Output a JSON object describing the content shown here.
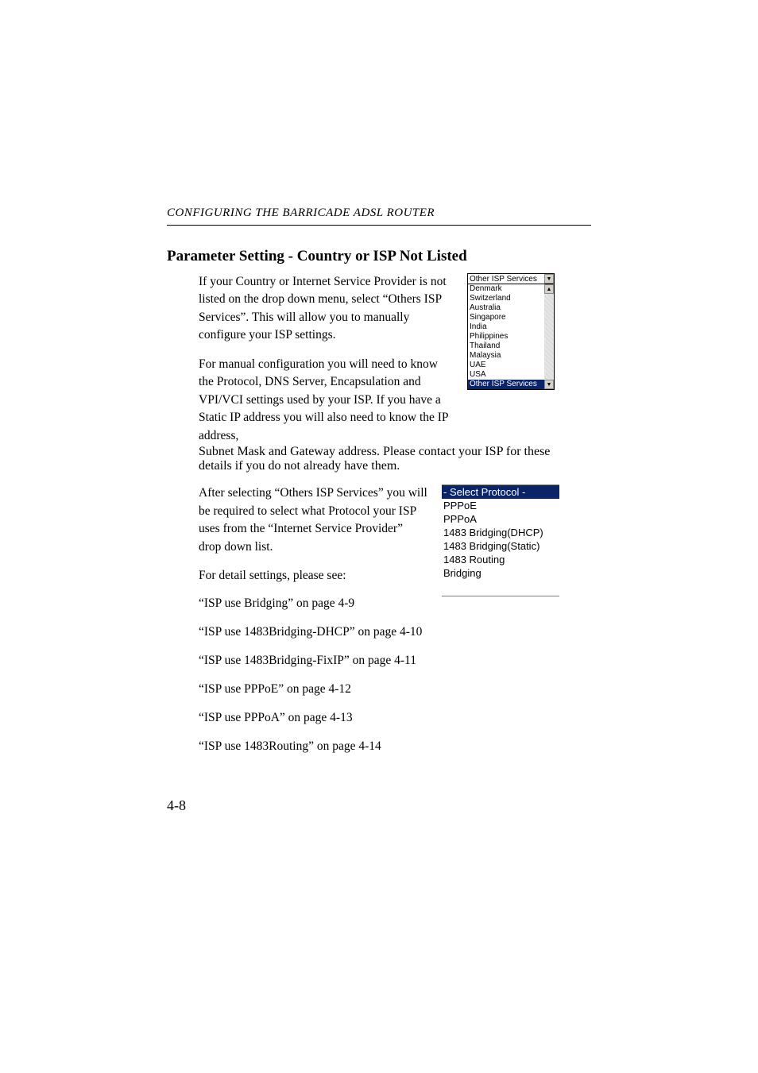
{
  "running_head": "CONFIGURING THE BARRICADE ADSL ROUTER",
  "section_heading": "Parameter Setting - Country or ISP Not Listed",
  "para1": "If your Country or Internet Service Provider is not listed on the drop down menu, select “Others ISP Services”. This will allow you to manually configure your ISP settings.",
  "para2": "For manual configuration you will need to know the Protocol, DNS Server, Encapsulation and VPI/VCI settings used by your ISP. If you have a Static IP address you will also need to know the IP address, Subnet Mask and Gateway address. Please contact your ISP for these details if you do not already have them.",
  "para2a": "For manual configuration you will need to know the Protocol, DNS Server, Encapsulation and VPI/VCI settings used by your ISP. If you have a Static IP address you will also need to know the IP address,",
  "para2b": "Subnet Mask and Gateway address. Please contact your ISP for these details if you do not already have them.",
  "para3": "After selecting “Others ISP Services” you will be required to select what Protocol your ISP uses from the “Internet Service Provider” drop down list.",
  "para4": "For detail settings, please see:",
  "refs": [
    "“ISP use Bridging” on page 4-9",
    "“ISP use 1483Bridging-DHCP” on page 4-10",
    "“ISP use 1483Bridging-FixIP” on page 4-11",
    "“ISP use PPPoE” on page 4-12",
    "“ISP use PPPoA” on page 4-13",
    "“ISP use 1483Routing” on page 4-14"
  ],
  "page_number": "4-8",
  "country_dropdown": {
    "selected": "Other ISP Services",
    "items": [
      "Denmark",
      "Switzerland",
      "Australia",
      "Singapore",
      "India",
      "Philippines",
      "Thailand",
      "Malaysia",
      "UAE",
      "USA",
      "Other ISP Services"
    ],
    "highlighted_index": 10
  },
  "protocol_list": {
    "items": [
      "- Select Protocol -",
      "PPPoE",
      "PPPoA",
      "1483 Bridging(DHCP)",
      "1483 Bridging(Static)",
      "1483 Routing",
      "Bridging"
    ],
    "highlighted_index": 0
  },
  "icons": {
    "down": "▼",
    "up": "▲"
  }
}
